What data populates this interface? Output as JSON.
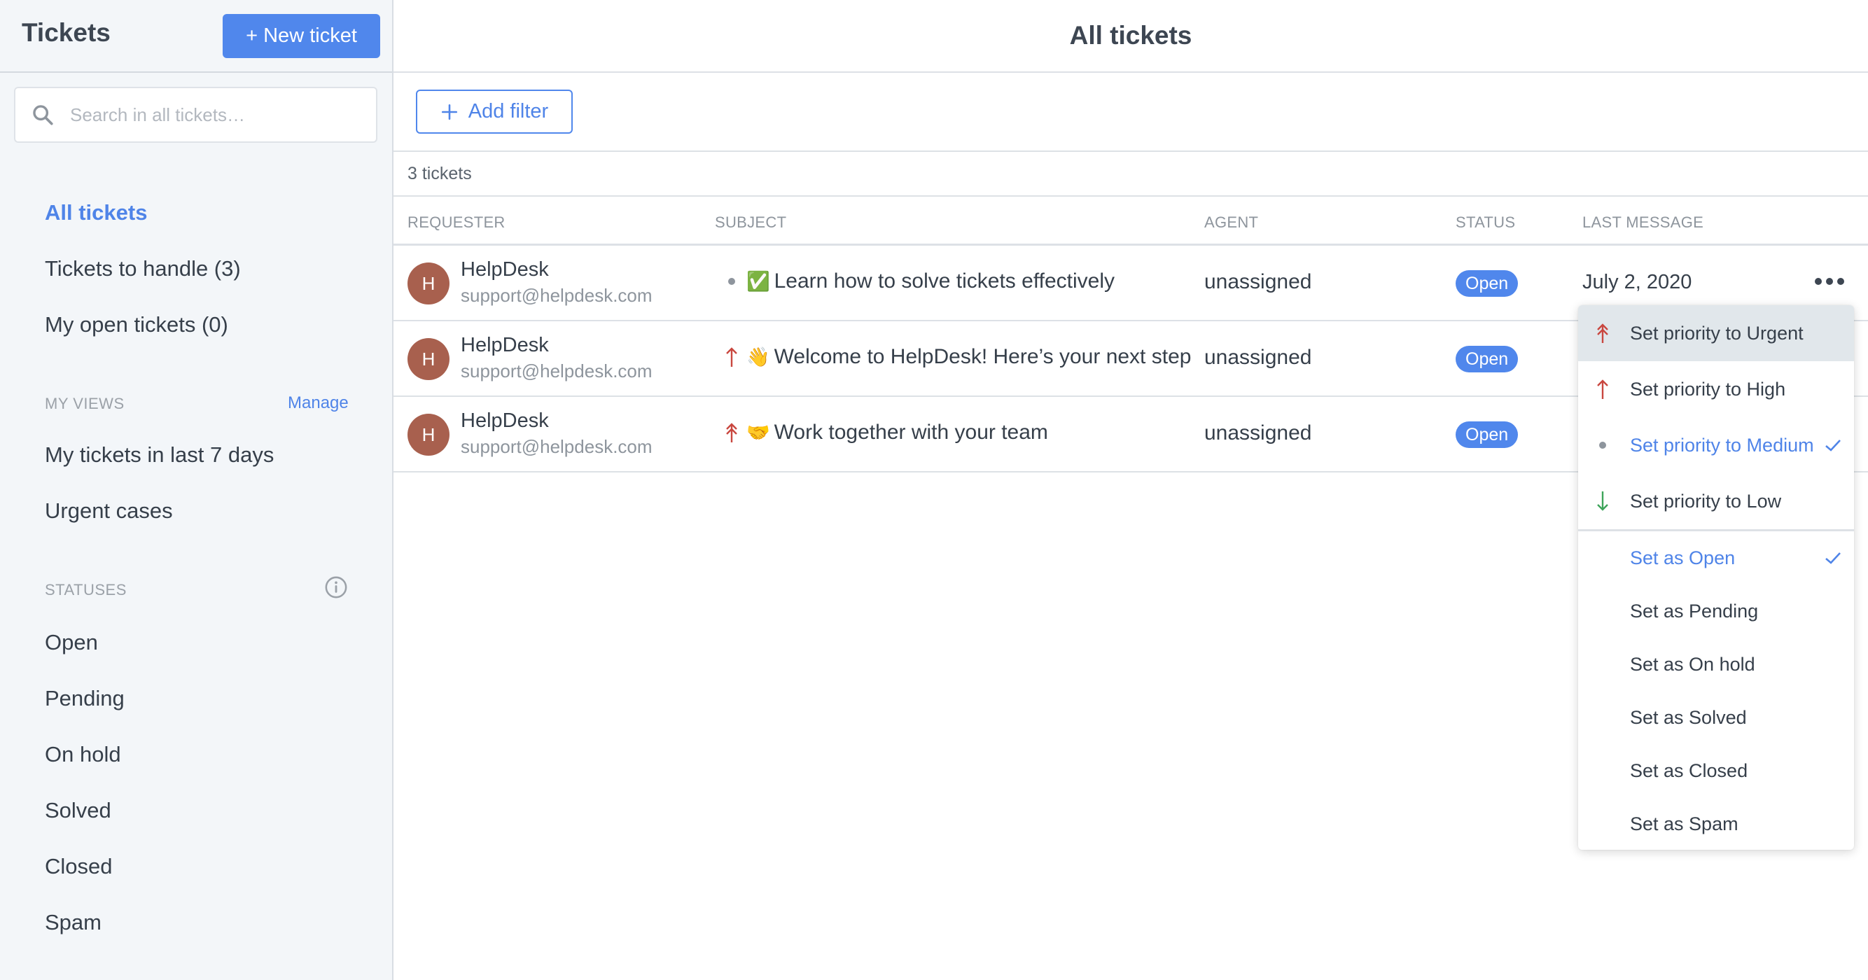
{
  "sidebar": {
    "title": "Tickets",
    "new_ticket_label": "+ New ticket",
    "search_placeholder": "Search in all tickets…",
    "main_items": [
      {
        "label": "All tickets",
        "active": true
      },
      {
        "label": "Tickets to handle (3)",
        "active": false
      },
      {
        "label": "My open tickets (0)",
        "active": false
      }
    ],
    "views_section": {
      "label": "MY VIEWS",
      "manage_label": "Manage",
      "items": [
        {
          "label": "My tickets in last 7 days"
        },
        {
          "label": "Urgent cases"
        }
      ]
    },
    "statuses_section": {
      "label": "STATUSES",
      "info_icon": "info-icon",
      "items": [
        {
          "label": "Open"
        },
        {
          "label": "Pending"
        },
        {
          "label": "On hold"
        },
        {
          "label": "Solved"
        },
        {
          "label": "Closed"
        },
        {
          "label": "Spam"
        }
      ]
    }
  },
  "main": {
    "title": "All tickets",
    "add_filter_label": "Add filter",
    "ticket_count": "3 tickets",
    "columns": [
      "REQUESTER",
      "SUBJECT",
      "AGENT",
      "STATUS",
      "LAST MESSAGE"
    ],
    "tickets": [
      {
        "avatar_initial": "H",
        "requester_name": "HelpDesk",
        "requester_email": "support@helpdesk.com",
        "priority": "medium",
        "emoji": "✅",
        "subject": "Learn how to solve tickets effectively",
        "agent": "unassigned",
        "status": "Open",
        "last_message": "July 2, 2020"
      },
      {
        "avatar_initial": "H",
        "requester_name": "HelpDesk",
        "requester_email": "support@helpdesk.com",
        "priority": "high",
        "emoji": "👋",
        "subject": "Welcome to HelpDesk! Here’s your next step",
        "agent": "unassigned",
        "status": "Open",
        "last_message": ""
      },
      {
        "avatar_initial": "H",
        "requester_name": "HelpDesk",
        "requester_email": "support@helpdesk.com",
        "priority": "urgent",
        "emoji": "🤝",
        "subject": "Work together with your team",
        "agent": "unassigned",
        "status": "Open",
        "last_message": ""
      }
    ]
  },
  "dropdown": {
    "priority_items": [
      {
        "label": "Set priority to Urgent",
        "icon": "urgent-priority-icon",
        "hovered": true,
        "selected": false
      },
      {
        "label": "Set priority to High",
        "icon": "high-priority-icon",
        "hovered": false,
        "selected": false
      },
      {
        "label": "Set priority to Medium",
        "icon": "medium-priority-icon",
        "hovered": false,
        "selected": true
      },
      {
        "label": "Set priority to Low",
        "icon": "low-priority-icon",
        "hovered": false,
        "selected": false
      }
    ],
    "status_items": [
      {
        "label": "Set as Open",
        "selected": true
      },
      {
        "label": "Set as Pending",
        "selected": false
      },
      {
        "label": "Set as On hold",
        "selected": false
      },
      {
        "label": "Set as Solved",
        "selected": false
      },
      {
        "label": "Set as Closed",
        "selected": false
      },
      {
        "label": "Set as Spam",
        "selected": false
      }
    ]
  },
  "colors": {
    "accent": "#5087ec",
    "link": "#4f84e8",
    "avatar": "#a8604e",
    "priority_up": "#c9473f",
    "priority_low": "#3ea45a",
    "priority_medium": "#8e959d",
    "sidebar_bg": "#f3f6f9",
    "hover_bg": "#e1e7eb"
  }
}
